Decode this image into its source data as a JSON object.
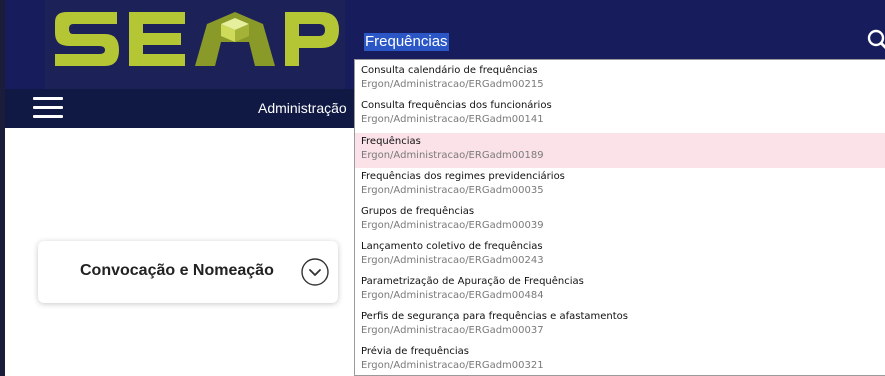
{
  "header": {
    "logo_text": "SEAP"
  },
  "nav": {
    "link_label": "Administração"
  },
  "search": {
    "query": "Frequências"
  },
  "dropdown": {
    "items": [
      {
        "title": "Consulta calendário de frequências",
        "path": "Ergon/Administracao/ERGadm00215",
        "highlighted": false
      },
      {
        "title": "Consulta frequências dos funcionários",
        "path": "Ergon/Administracao/ERGadm00141",
        "highlighted": false
      },
      {
        "title": "Frequências",
        "path": "Ergon/Administracao/ERGadm00189",
        "highlighted": true
      },
      {
        "title": "Frequências dos regimes previdenciários",
        "path": "Ergon/Administracao/ERGadm00035",
        "highlighted": false
      },
      {
        "title": "Grupos de frequências",
        "path": "Ergon/Administracao/ERGadm00039",
        "highlighted": false
      },
      {
        "title": "Lançamento coletivo de frequências",
        "path": "Ergon/Administracao/ERGadm00243",
        "highlighted": false
      },
      {
        "title": "Parametrização de Apuração de Frequências",
        "path": "Ergon/Administracao/ERGadm00484",
        "highlighted": false
      },
      {
        "title": "Perfis de segurança para frequências e afastamentos",
        "path": "Ergon/Administracao/ERGadm00037",
        "highlighted": false
      },
      {
        "title": "Prévia de frequências",
        "path": "Ergon/Administracao/ERGadm00321",
        "highlighted": false
      }
    ]
  },
  "card": {
    "title": "Convocação e Nomeação"
  },
  "colors": {
    "header_bg": "#171c5c",
    "nav_bg": "#0f1943",
    "logo_green": "#b5c635",
    "highlight_bg": "#fbe2e8",
    "selection_bg": "#2a56c6"
  },
  "icons": {
    "menu": "hamburger-icon",
    "search": "search-icon",
    "toggle": "chevron-down-icon"
  }
}
